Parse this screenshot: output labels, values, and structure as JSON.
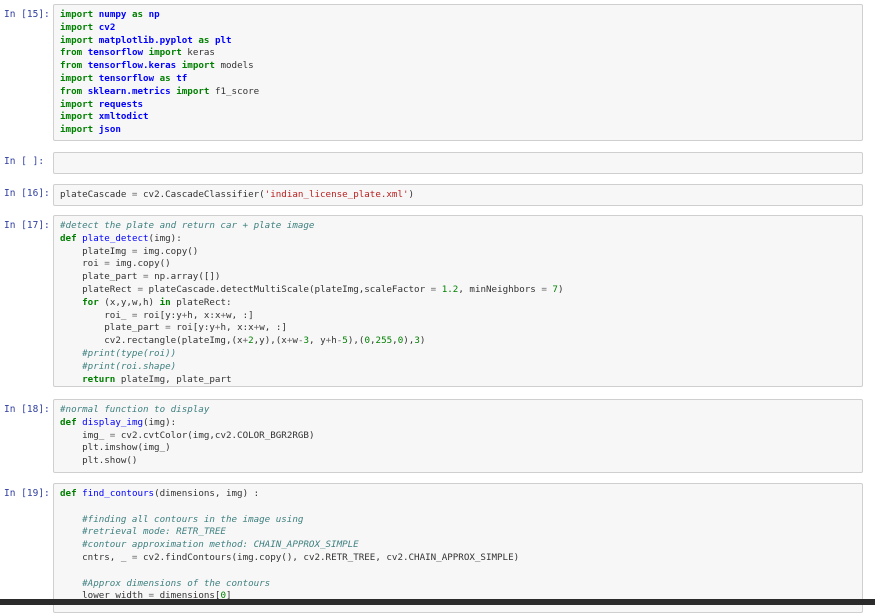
{
  "cells": [
    {
      "id": "c15",
      "prompt": "In [15]:",
      "lines": [
        [
          [
            "kw",
            "import"
          ],
          [
            "t",
            " "
          ],
          [
            "mod",
            "numpy"
          ],
          [
            "t",
            " "
          ],
          [
            "kw",
            "as"
          ],
          [
            "t",
            " "
          ],
          [
            "mod",
            "np"
          ]
        ],
        [
          [
            "kw",
            "import"
          ],
          [
            "t",
            " "
          ],
          [
            "mod",
            "cv2"
          ]
        ],
        [
          [
            "kw",
            "import"
          ],
          [
            "t",
            " "
          ],
          [
            "mod",
            "matplotlib.pyplot"
          ],
          [
            "t",
            " "
          ],
          [
            "kw",
            "as"
          ],
          [
            "t",
            " "
          ],
          [
            "mod",
            "plt"
          ]
        ],
        [
          [
            "kw",
            "from"
          ],
          [
            "t",
            " "
          ],
          [
            "mod",
            "tensorflow"
          ],
          [
            "t",
            " "
          ],
          [
            "kw",
            "import"
          ],
          [
            "t",
            " keras"
          ]
        ],
        [
          [
            "kw",
            "from"
          ],
          [
            "t",
            " "
          ],
          [
            "mod",
            "tensorflow.keras"
          ],
          [
            "t",
            " "
          ],
          [
            "kw",
            "import"
          ],
          [
            "t",
            " models"
          ]
        ],
        [
          [
            "kw",
            "import"
          ],
          [
            "t",
            " "
          ],
          [
            "mod",
            "tensorflow"
          ],
          [
            "t",
            " "
          ],
          [
            "kw",
            "as"
          ],
          [
            "t",
            " "
          ],
          [
            "mod",
            "tf"
          ]
        ],
        [
          [
            "kw",
            "from"
          ],
          [
            "t",
            " "
          ],
          [
            "mod",
            "sklearn.metrics"
          ],
          [
            "t",
            " "
          ],
          [
            "kw",
            "import"
          ],
          [
            "t",
            " f1_score"
          ]
        ],
        [
          [
            "kw",
            "import"
          ],
          [
            "t",
            " "
          ],
          [
            "mod",
            "requests"
          ]
        ],
        [
          [
            "kw",
            "import"
          ],
          [
            "t",
            " "
          ],
          [
            "mod",
            "xmltodict"
          ]
        ],
        [
          [
            "kw",
            "import"
          ],
          [
            "t",
            " "
          ],
          [
            "mod",
            "json"
          ]
        ]
      ]
    },
    {
      "id": "cEmpty",
      "prompt": "In [ ]:",
      "lines": [
        [
          [
            "t",
            ""
          ]
        ]
      ]
    },
    {
      "id": "c16",
      "prompt": "In [16]:",
      "lines": [
        [
          [
            "t",
            "plateCascade "
          ],
          [
            "op",
            "="
          ],
          [
            "t",
            " cv2.CascadeClassifier("
          ],
          [
            "str",
            "'indian_license_plate.xml'"
          ],
          [
            "t",
            ")"
          ]
        ]
      ]
    },
    {
      "id": "c17",
      "prompt": "In [17]:",
      "lines": [
        [
          [
            "cm",
            "#detect the plate and return car + plate image"
          ]
        ],
        [
          [
            "kw",
            "def"
          ],
          [
            "t",
            " "
          ],
          [
            "fn",
            "plate_detect"
          ],
          [
            "t",
            "(img):"
          ]
        ],
        [
          [
            "t",
            "    plateImg "
          ],
          [
            "op",
            "="
          ],
          [
            "t",
            " img.copy()"
          ]
        ],
        [
          [
            "t",
            "    roi "
          ],
          [
            "op",
            "="
          ],
          [
            "t",
            " img.copy()"
          ]
        ],
        [
          [
            "t",
            "    plate_part "
          ],
          [
            "op",
            "="
          ],
          [
            "t",
            " np.array([])"
          ]
        ],
        [
          [
            "t",
            "    plateRect "
          ],
          [
            "op",
            "="
          ],
          [
            "t",
            " plateCascade.detectMultiScale(plateImg,scaleFactor "
          ],
          [
            "op",
            "="
          ],
          [
            "t",
            " "
          ],
          [
            "num",
            "1.2"
          ],
          [
            "t",
            ", minNeighbors "
          ],
          [
            "op",
            "="
          ],
          [
            "t",
            " "
          ],
          [
            "num",
            "7"
          ],
          [
            "t",
            ")"
          ]
        ],
        [
          [
            "t",
            "    "
          ],
          [
            "kw",
            "for"
          ],
          [
            "t",
            " (x,y,w,h) "
          ],
          [
            "kw",
            "in"
          ],
          [
            "t",
            " plateRect:"
          ]
        ],
        [
          [
            "t",
            "        roi_ "
          ],
          [
            "op",
            "="
          ],
          [
            "t",
            " roi[y:y"
          ],
          [
            "op",
            "+"
          ],
          [
            "t",
            "h, x:x"
          ],
          [
            "op",
            "+"
          ],
          [
            "t",
            "w, :]"
          ]
        ],
        [
          [
            "t",
            "        plate_part "
          ],
          [
            "op",
            "="
          ],
          [
            "t",
            " roi[y:y"
          ],
          [
            "op",
            "+"
          ],
          [
            "t",
            "h, x:x"
          ],
          [
            "op",
            "+"
          ],
          [
            "t",
            "w, :]"
          ]
        ],
        [
          [
            "t",
            "        cv2.rectangle(plateImg,(x"
          ],
          [
            "op",
            "+"
          ],
          [
            "num",
            "2"
          ],
          [
            "t",
            ",y),(x"
          ],
          [
            "op",
            "+"
          ],
          [
            "t",
            "w"
          ],
          [
            "op",
            "-"
          ],
          [
            "num",
            "3"
          ],
          [
            "t",
            ", y"
          ],
          [
            "op",
            "+"
          ],
          [
            "t",
            "h"
          ],
          [
            "op",
            "-"
          ],
          [
            "num",
            "5"
          ],
          [
            "t",
            "),("
          ],
          [
            "num",
            "0"
          ],
          [
            "t",
            ","
          ],
          [
            "num",
            "255"
          ],
          [
            "t",
            ","
          ],
          [
            "num",
            "0"
          ],
          [
            "t",
            "),"
          ],
          [
            "num",
            "3"
          ],
          [
            "t",
            ")"
          ]
        ],
        [
          [
            "t",
            "    "
          ],
          [
            "cm",
            "#print(type(roi))"
          ]
        ],
        [
          [
            "t",
            "    "
          ],
          [
            "cm",
            "#print(roi.shape)"
          ]
        ],
        [
          [
            "t",
            "    "
          ],
          [
            "kw",
            "return"
          ],
          [
            "t",
            " plateImg, plate_part"
          ]
        ]
      ]
    },
    {
      "id": "c18",
      "prompt": "In [18]:",
      "lines": [
        [
          [
            "cm",
            "#normal function to display"
          ]
        ],
        [
          [
            "kw",
            "def"
          ],
          [
            "t",
            " "
          ],
          [
            "fn",
            "display_img"
          ],
          [
            "t",
            "(img):"
          ]
        ],
        [
          [
            "t",
            "    img_ "
          ],
          [
            "op",
            "="
          ],
          [
            "t",
            " cv2.cvtColor(img,cv2.COLOR_BGR2RGB)"
          ]
        ],
        [
          [
            "t",
            "    plt.imshow(img_)"
          ]
        ],
        [
          [
            "t",
            "    plt.show()"
          ]
        ]
      ]
    },
    {
      "id": "c19",
      "prompt": "In [19]:",
      "lines": [
        [
          [
            "kw",
            "def"
          ],
          [
            "t",
            " "
          ],
          [
            "fn",
            "find_contours"
          ],
          [
            "t",
            "(dimensions, img) :"
          ]
        ],
        [
          [
            "t",
            ""
          ]
        ],
        [
          [
            "t",
            "    "
          ],
          [
            "cm",
            "#finding all contours in the image using"
          ]
        ],
        [
          [
            "t",
            "    "
          ],
          [
            "cm",
            "#retrieval mode: RETR_TREE"
          ]
        ],
        [
          [
            "t",
            "    "
          ],
          [
            "cm",
            "#contour approximation method: CHAIN_APPROX_SIMPLE"
          ]
        ],
        [
          [
            "t",
            "    cntrs, _ "
          ],
          [
            "op",
            "="
          ],
          [
            "t",
            " cv2.findContours(img.copy(), cv2.RETR_TREE, cv2.CHAIN_APPROX_SIMPLE)"
          ]
        ],
        [
          [
            "t",
            ""
          ]
        ],
        [
          [
            "t",
            "    "
          ],
          [
            "cm",
            "#Approx dimensions of the contours"
          ]
        ],
        [
          [
            "t",
            "    lower_width "
          ],
          [
            "op",
            "="
          ],
          [
            "t",
            " dimensions["
          ],
          [
            "num",
            "0"
          ],
          [
            "t",
            "]"
          ]
        ]
      ]
    }
  ]
}
